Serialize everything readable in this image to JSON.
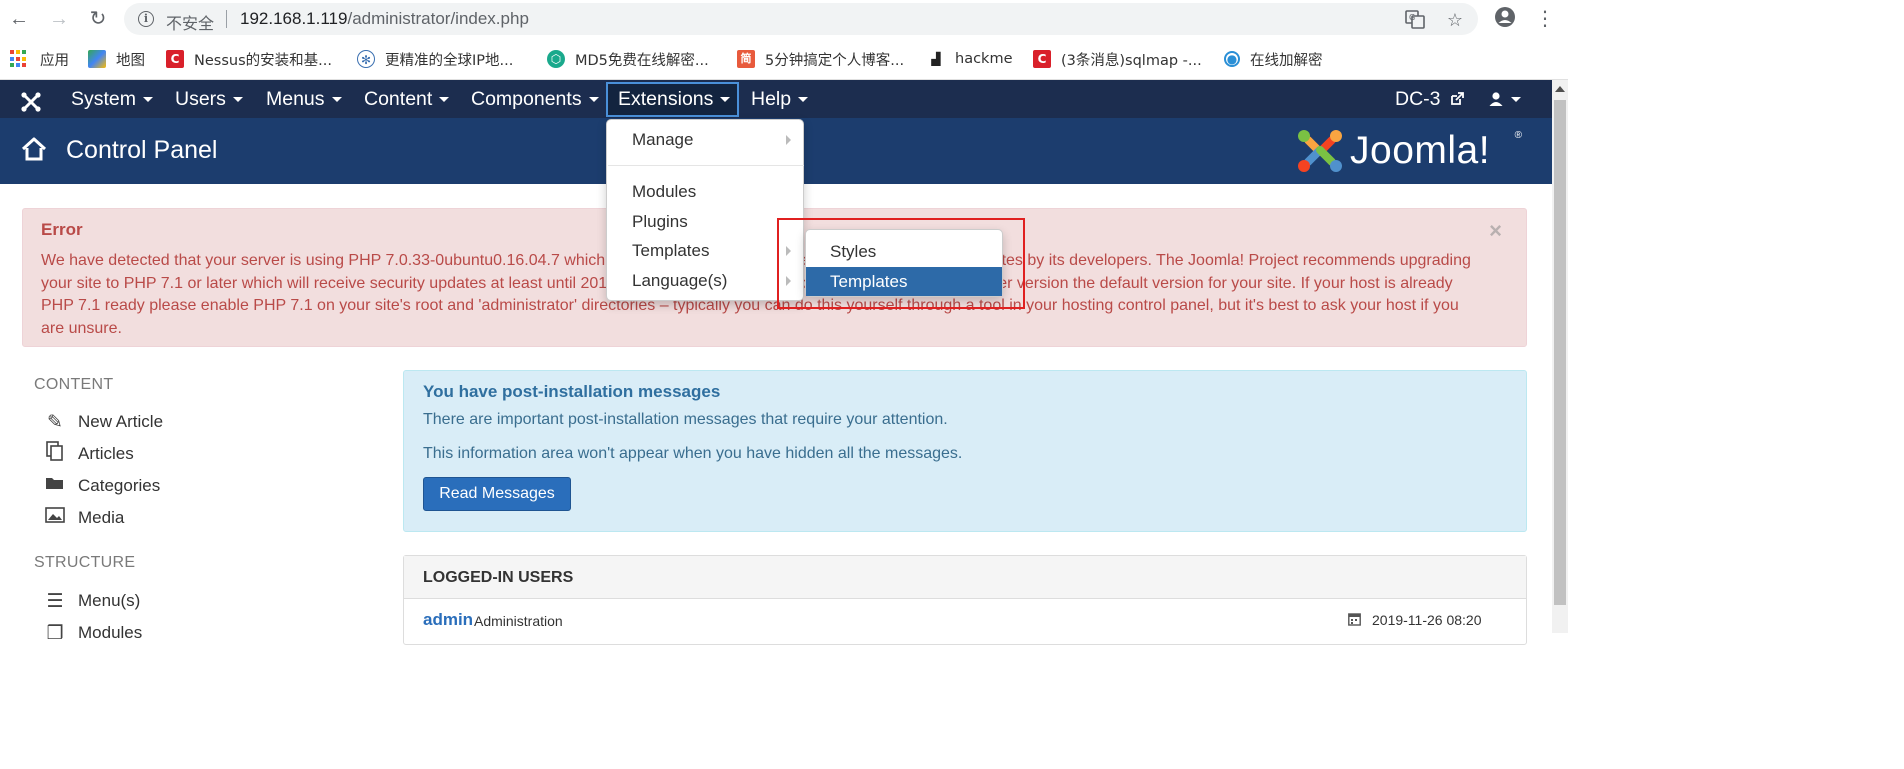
{
  "browser": {
    "insecure_label": "不安全",
    "url_host": "192.168.1.119",
    "url_path": "/administrator/index.php",
    "bookmarks": [
      {
        "label": "应用",
        "icon": "apps-grid-icon"
      },
      {
        "label": "地图",
        "icon": "maps-icon"
      },
      {
        "label": "Nessus的安装和基...",
        "icon": "csdn-icon"
      },
      {
        "label": "更精准的全球IP地...",
        "icon": "ip-globe-icon"
      },
      {
        "label": "MD5免费在线解密...",
        "icon": "md5-icon"
      },
      {
        "label": "5分钟搞定个人博客...",
        "icon": "jianshu-icon"
      },
      {
        "label": "hackme",
        "icon": "hackme-icon"
      },
      {
        "label": "(3条消息)sqlmap -...",
        "icon": "csdn-icon"
      },
      {
        "label": "在线加解密",
        "icon": "crypto-icon"
      }
    ]
  },
  "navbar": {
    "items": [
      "System",
      "Users",
      "Menus",
      "Content",
      "Components",
      "Extensions",
      "Help"
    ],
    "site_name": "DC-3"
  },
  "header": {
    "title": "Control Panel",
    "logo_text": "Joomla!",
    "logo_reg": "®"
  },
  "error": {
    "title": "Error",
    "lines": [
      "We have detected that your server is using PHP 7.0.33-0ubuntu0.16.04.7 which is obsolete and no longer receives official security updates by its developers. The Joomla! Project recommends upgrading",
      "your site to PHP 7.1 or later which will receive security updates at least until 2019-12-01. Please ask your host to make PHP 7.1 or a later version the default version for your site. If your host is already",
      "PHP 7.1 ready please enable PHP 7.1 on your site's root and 'administrator' directories – typically you can do this yourself through a tool in your hosting control panel, but it's best to ask your host if you",
      "are unsure."
    ],
    "close": "×"
  },
  "extensions_menu": {
    "manage": "Manage",
    "modules": "Modules",
    "plugins": "Plugins",
    "templates": "Templates",
    "languages": "Language(s)"
  },
  "templates_submenu": {
    "styles": "Styles",
    "templates": "Templates"
  },
  "sidebar": {
    "content_heading": "CONTENT",
    "content_items": [
      "New Article",
      "Articles",
      "Categories",
      "Media"
    ],
    "structure_heading": "STRUCTURE",
    "structure_items": [
      "Menu(s)",
      "Modules"
    ]
  },
  "post_install": {
    "title": "You have post-installation messages",
    "line1": "There are important post-installation messages that require your attention.",
    "line2": "This information area won't appear when you have hidden all the messages.",
    "button": "Read Messages"
  },
  "logged_in": {
    "title": "LOGGED-IN USERS",
    "user": "admin",
    "role": "Administration",
    "date": "2019-11-26 08:20"
  },
  "colors": {
    "navbar": "#1c2d4f",
    "header": "#1c3d6e",
    "error_bg": "#f2dede",
    "error_text": "#b94a48",
    "info_bg": "#d9edf7",
    "primary": "#2a6ebb",
    "highlight": "#e02020"
  }
}
